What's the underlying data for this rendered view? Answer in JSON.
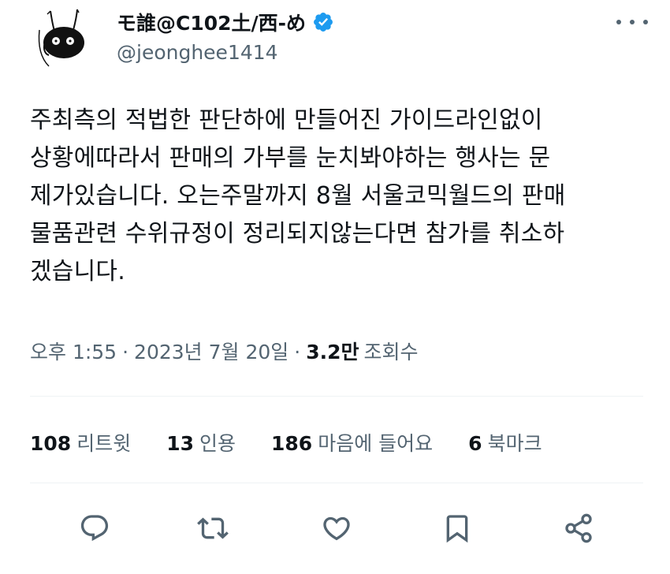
{
  "author": {
    "display_name": "モ誰@C102土/西-め",
    "handle": "@jeonghee1414",
    "avatar_icon": "avatar-icon",
    "verified_icon": "verified-badge-icon",
    "verified_color": "#1d9bf0"
  },
  "tweet": {
    "text": "주최측의 적법한 판단하에 만들어진 가이드라인없이\n상황에따라서 판매의 가부를 눈치봐야하는 행사는 문\n제가있습니다. 오는주말까지 8월 서울코믹월드의 판매\n물품관련 수위규정이 정리되지않는다면 참가를 취소하\n겠습니다."
  },
  "meta": {
    "time": "오후 1:55",
    "separator": "·",
    "date": "2023년 7월 20일",
    "views_count": "3.2만",
    "views_label": "조회수"
  },
  "stats": {
    "retweets": {
      "count": "108",
      "label": "리트윗"
    },
    "quotes": {
      "count": "13",
      "label": "인용"
    },
    "likes": {
      "count": "186",
      "label": "마음에 들어요"
    },
    "bookmarks": {
      "count": "6",
      "label": "북마크"
    }
  },
  "actions": [
    {
      "icon": "reply-icon"
    },
    {
      "icon": "retweet-icon"
    },
    {
      "icon": "like-icon"
    },
    {
      "icon": "bookmark-icon"
    },
    {
      "icon": "share-icon"
    }
  ],
  "colors": {
    "text": "#0f1419",
    "secondary": "#536471",
    "divider": "#eff3f4"
  }
}
